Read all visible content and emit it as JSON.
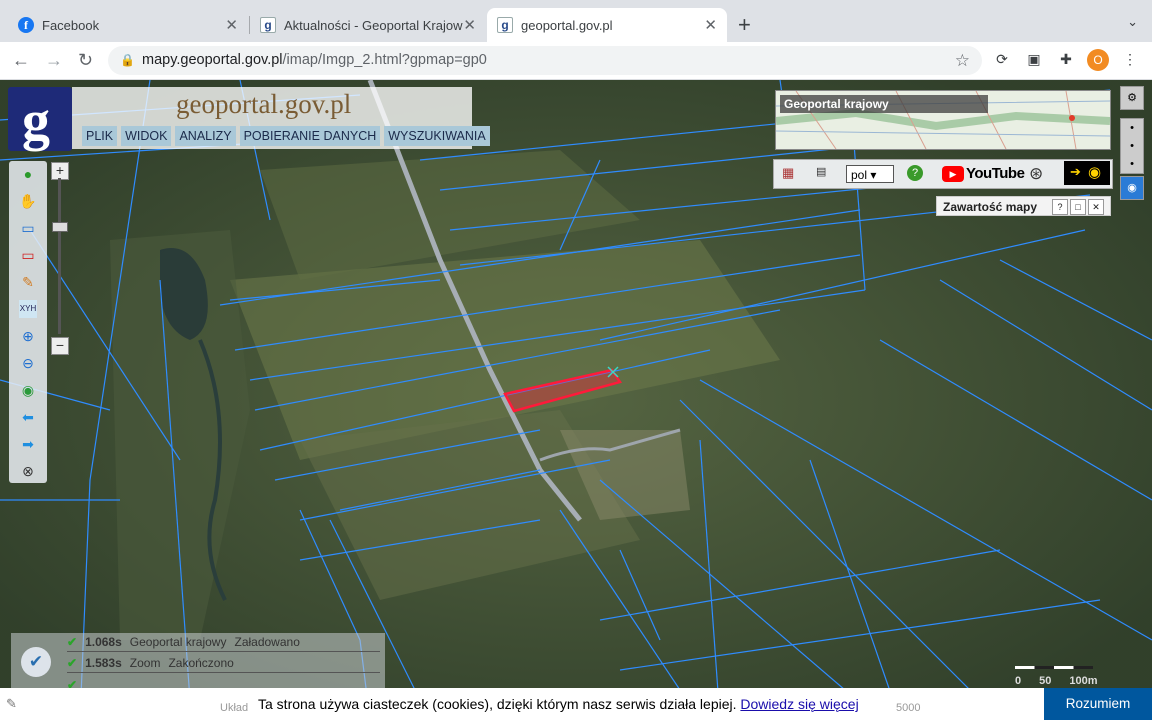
{
  "browser": {
    "tabs": [
      {
        "title": "Facebook",
        "icon": "facebook-icon",
        "active": false
      },
      {
        "title": "Aktualności - Geoportal Krajow",
        "icon": "geoportal-icon",
        "active": false
      },
      {
        "title": "geoportal.gov.pl",
        "icon": "geoportal-icon",
        "active": true
      }
    ],
    "url_domain": "mapy.geoportal.gov.pl",
    "url_path": "/imap/Imgp_2.html?gpmap=gp0",
    "profile_initial": "O"
  },
  "app": {
    "brand": "geoportal.gov.pl",
    "logo_letter": "g",
    "menu": [
      "PLIK",
      "WIDOK",
      "ANALIZY",
      "POBIERANIE DANYCH",
      "WYSZUKIWANIA"
    ],
    "overview_title": "Geoportal krajowy",
    "language": "pol",
    "youtube_label": "YouTube",
    "map_content_panel": "Zawartość mapy",
    "left_tools": [
      "info-icon",
      "pan-hand-icon",
      "select-rect-icon",
      "clear-select-icon",
      "pencil-icon",
      "xyh-icon",
      "zoom-in-icon",
      "zoom-out-icon",
      "globe-icon",
      "back-arrow-icon",
      "forward-arrow-icon",
      "reset-icon"
    ],
    "xyh_label": "XYH"
  },
  "status": {
    "rows": [
      {
        "time": "1.068s",
        "source": "Geoportal krajowy",
        "state": "Załadowano"
      },
      {
        "time": "1.583s",
        "source": "Zoom",
        "state": "Zakończono"
      }
    ]
  },
  "scale": {
    "labels": [
      "0",
      "50",
      "100m"
    ],
    "partial_left": "Układ",
    "partial_right": "5000"
  },
  "cookie": {
    "message": "Ta strona używa ciasteczek (cookies), dzięki którym nasz serwis działa lepiej.",
    "link": "Dowiedz się więcej",
    "button": "Rozumiem"
  },
  "colors": {
    "parcel_lines": "#2f8cff",
    "highlight": "#ff1a3a",
    "map_bg": "#3d4d34"
  }
}
